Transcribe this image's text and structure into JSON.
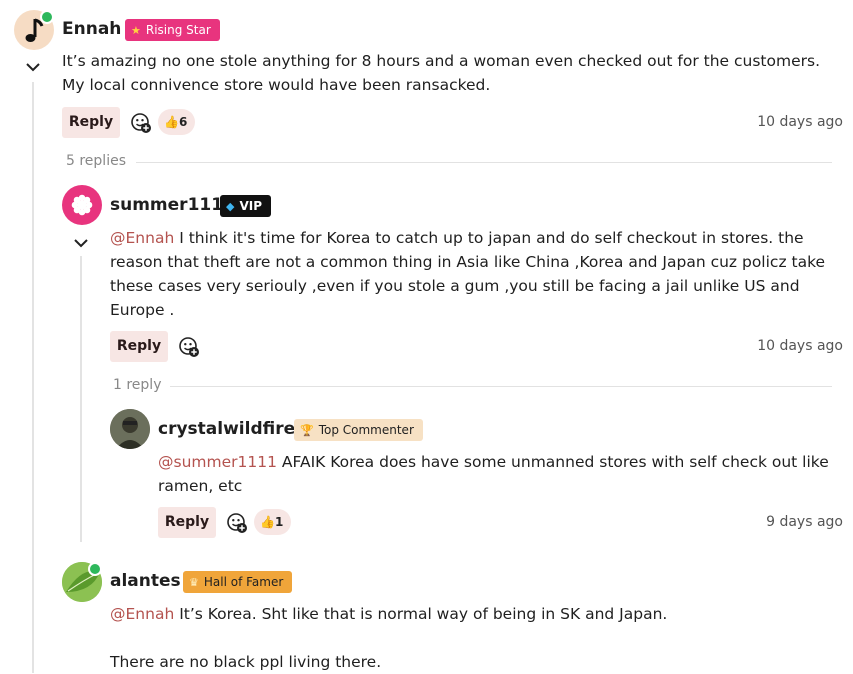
{
  "colors": {
    "mention": "#b4534f",
    "reply_bg": "#f7e6e4",
    "rising_star": "#e8347e",
    "vip": "#111111",
    "top_commenter": "#f7e1c4",
    "hall_of_famer": "#f0a53a",
    "online": "#2eb85c"
  },
  "comments": [
    {
      "username": "Ennah",
      "badge": "Rising Star",
      "badge_icon": "star-icon",
      "text": "It’s amazing no one stole anything for 8 hours and a woman even checked out for the customers. My local connivence store would have been ransacked.",
      "reply_label": "Reply",
      "reaction_count": "6",
      "time": "10 days ago",
      "replies_label": "5 replies"
    },
    {
      "username": "summer1111",
      "badge": "VIP",
      "badge_icon": "diamond-icon",
      "mention": "@Ennah",
      "text": " I think it's time for Korea to catch up to japan and do self checkout in stores. the reason that theft are not a common thing in Asia like China ,Korea and Japan cuz policz take these cases very seriouly ,even if you stole a gum ,you still be facing a jail unlike US and Europe .",
      "reply_label": "Reply",
      "time": "10 days ago",
      "replies_label": "1 reply"
    },
    {
      "username": "crystalwildfire",
      "badge": "Top Commenter",
      "badge_icon": "trophy-icon",
      "mention": "@summer1111",
      "text": " AFAIK Korea does have some unmanned stores with self check out like ramen, etc",
      "reply_label": "Reply",
      "reaction_count": "1",
      "time": "9 days ago"
    },
    {
      "username": "alantes",
      "badge": "Hall of Famer",
      "badge_icon": "crown-icon",
      "mention": "@Ennah",
      "text": " It’s Korea. Sht like that is normal way of being in SK and Japan.",
      "text2": "There are no black ppl living there."
    }
  ]
}
